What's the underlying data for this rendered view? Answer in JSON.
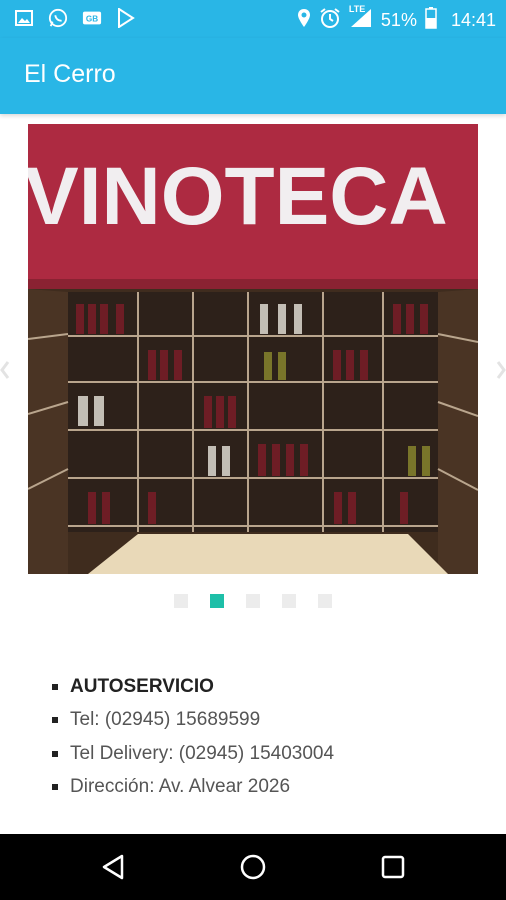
{
  "status_bar": {
    "battery": "51%",
    "time": "14:41",
    "network": "LTE",
    "icons_left": [
      "image-icon",
      "whatsapp-icon",
      "gb-icon",
      "play-store-icon"
    ],
    "icons_right": [
      "location-icon",
      "alarm-icon",
      "signal-icon",
      "battery-icon"
    ]
  },
  "app_bar": {
    "title": "El Cerro",
    "color": "#29b6e6"
  },
  "carousel": {
    "sign_text": "VINOTECA",
    "slide_count": 5,
    "active_index": 1,
    "dot_active_color": "#1ebfa8"
  },
  "info": {
    "items": [
      "AUTOSERVICIO",
      "Tel: (02945) 15689599",
      "Tel Delivery: (02945) 15403004",
      "Dirección: Av. Alvear 2026"
    ]
  },
  "nav_bar": {
    "buttons": [
      "back-button",
      "home-button",
      "recents-button"
    ]
  }
}
